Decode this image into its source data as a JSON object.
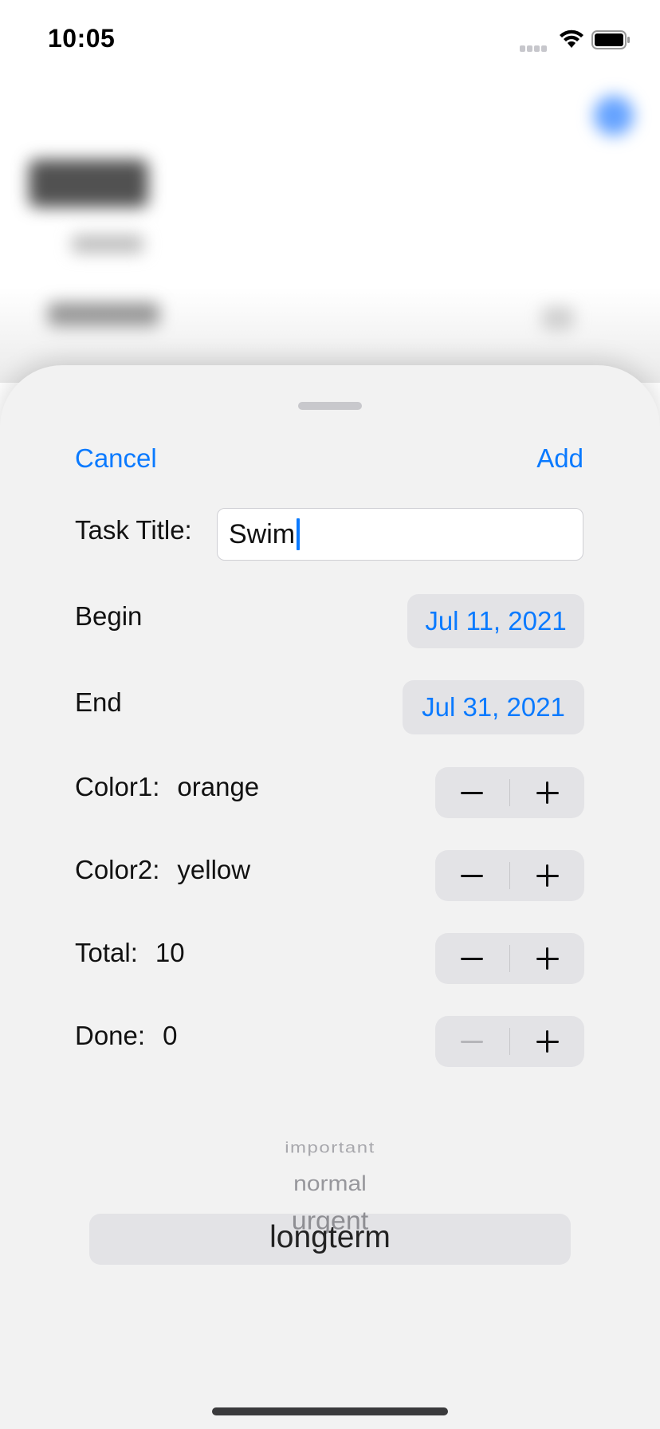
{
  "status_bar": {
    "time": "10:05"
  },
  "sheet": {
    "cancel_label": "Cancel",
    "add_label": "Add",
    "task_title": {
      "label": "Task Title:",
      "value": "Swim"
    },
    "begin": {
      "label": "Begin",
      "date": "Jul 11, 2021"
    },
    "end": {
      "label": "End",
      "date": "Jul 31, 2021"
    },
    "color1": {
      "label": "Color1:",
      "value": "orange"
    },
    "color2": {
      "label": "Color2:",
      "value": "yellow"
    },
    "total": {
      "label": "Total:",
      "value": "10"
    },
    "done": {
      "label": "Done:",
      "value": "0",
      "minus_disabled": true
    },
    "priority_picker": {
      "options": [
        "important",
        "normal",
        "urgent",
        "longterm"
      ],
      "selected": "longterm"
    }
  },
  "colors": {
    "accent": "#0a7aff",
    "sheet_background": "#f2f2f2",
    "control_fill": "#e3e3e6"
  },
  "icons": [
    "wifi-icon",
    "battery-icon",
    "cellular-signal-icon",
    "minus-icon",
    "plus-icon"
  ]
}
